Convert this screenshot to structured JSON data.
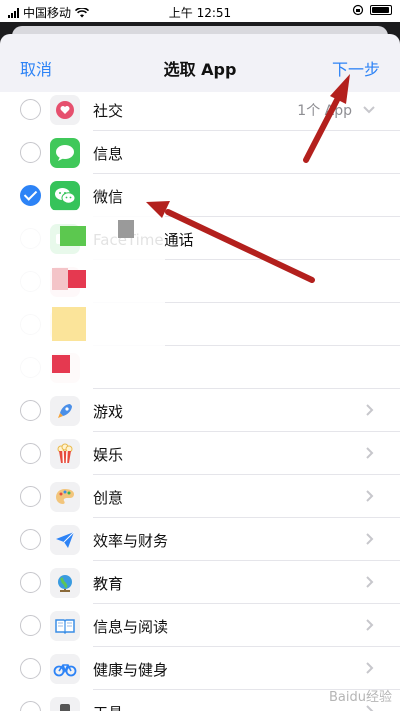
{
  "status_bar": {
    "carrier": "中国移动",
    "time": "上午 12:51"
  },
  "nav": {
    "cancel": "取消",
    "title": "选取 App",
    "next": "下一步"
  },
  "rows": [
    {
      "label": "社交",
      "detail": "1个 App",
      "icon": "social-heart-icon",
      "checked": false,
      "chevron": "down"
    },
    {
      "label": "信息",
      "icon": "messages-icon",
      "checked": false
    },
    {
      "label": "微信",
      "icon": "wechat-icon",
      "checked": true
    },
    {
      "label": "FaceTime通话",
      "label_visible": "me通话",
      "icon": "facetime-icon",
      "checked": false
    },
    {
      "label": "",
      "icon": "app-icon",
      "checked": false
    },
    {
      "label": "",
      "icon": "notes-icon",
      "checked": false
    },
    {
      "label": "",
      "icon": "app-icon",
      "checked": false
    },
    {
      "label": "游戏",
      "icon": "rocket-icon",
      "checked": false,
      "chevron": "right"
    },
    {
      "label": "娱乐",
      "icon": "popcorn-icon",
      "checked": false,
      "chevron": "right"
    },
    {
      "label": "创意",
      "icon": "palette-icon",
      "checked": false,
      "chevron": "right"
    },
    {
      "label": "效率与财务",
      "icon": "paper-plane-icon",
      "checked": false,
      "chevron": "right"
    },
    {
      "label": "教育",
      "icon": "globe-icon",
      "checked": false,
      "chevron": "right"
    },
    {
      "label": "信息与阅读",
      "icon": "book-icon",
      "checked": false,
      "chevron": "right"
    },
    {
      "label": "健康与健身",
      "icon": "bicycle-icon",
      "checked": false,
      "chevron": "right"
    },
    {
      "label": "工具",
      "icon": "tools-icon",
      "checked": false,
      "chevron": "right"
    }
  ],
  "watermark": "Baidu经验",
  "colors": {
    "accent": "#2d83f6",
    "annotation_arrow": "#b3201d"
  }
}
